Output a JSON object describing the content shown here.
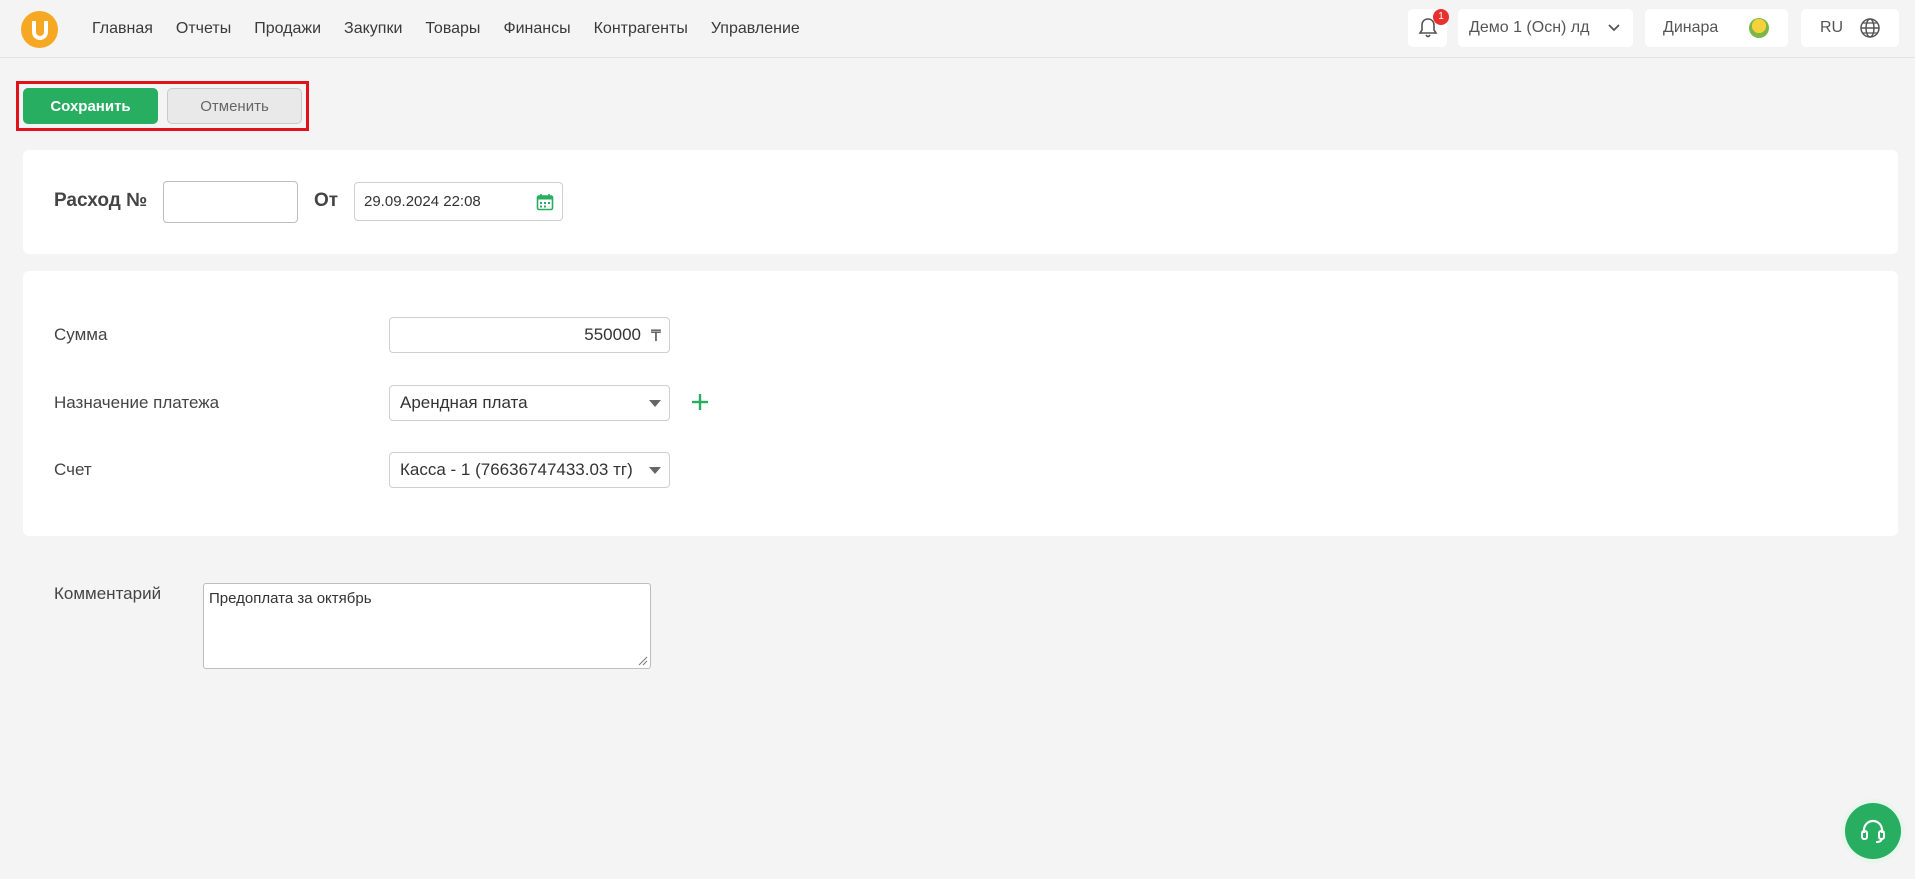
{
  "nav": {
    "items": [
      "Главная",
      "Отчеты",
      "Продажи",
      "Закупки",
      "Товары",
      "Финансы",
      "Контрагенты",
      "Управление"
    ]
  },
  "header": {
    "notifications_count": "1",
    "organization": "Демо 1 (Осн) лд",
    "user_name": "Динара",
    "language": "RU"
  },
  "toolbar": {
    "save_label": "Сохранить",
    "cancel_label": "Отменить"
  },
  "document": {
    "title_label": "Расход №",
    "number_value": "",
    "from_label": "От",
    "date_value": "29.09.2024 22:08"
  },
  "form": {
    "amount_label": "Сумма",
    "amount_value": "550000",
    "currency_symbol": "₸",
    "purpose_label": "Назначение платежа",
    "purpose_value": "Арендная плата",
    "account_label": "Счет",
    "account_value": "Касса - 1 (76636747433.03 тг)"
  },
  "comment": {
    "label": "Комментарий",
    "value": "Предоплата за октябрь"
  },
  "colors": {
    "accent_green": "#27ae60",
    "logo_orange": "#f7a823",
    "badge_red": "#e8302f",
    "highlight_red": "#e0131a"
  }
}
